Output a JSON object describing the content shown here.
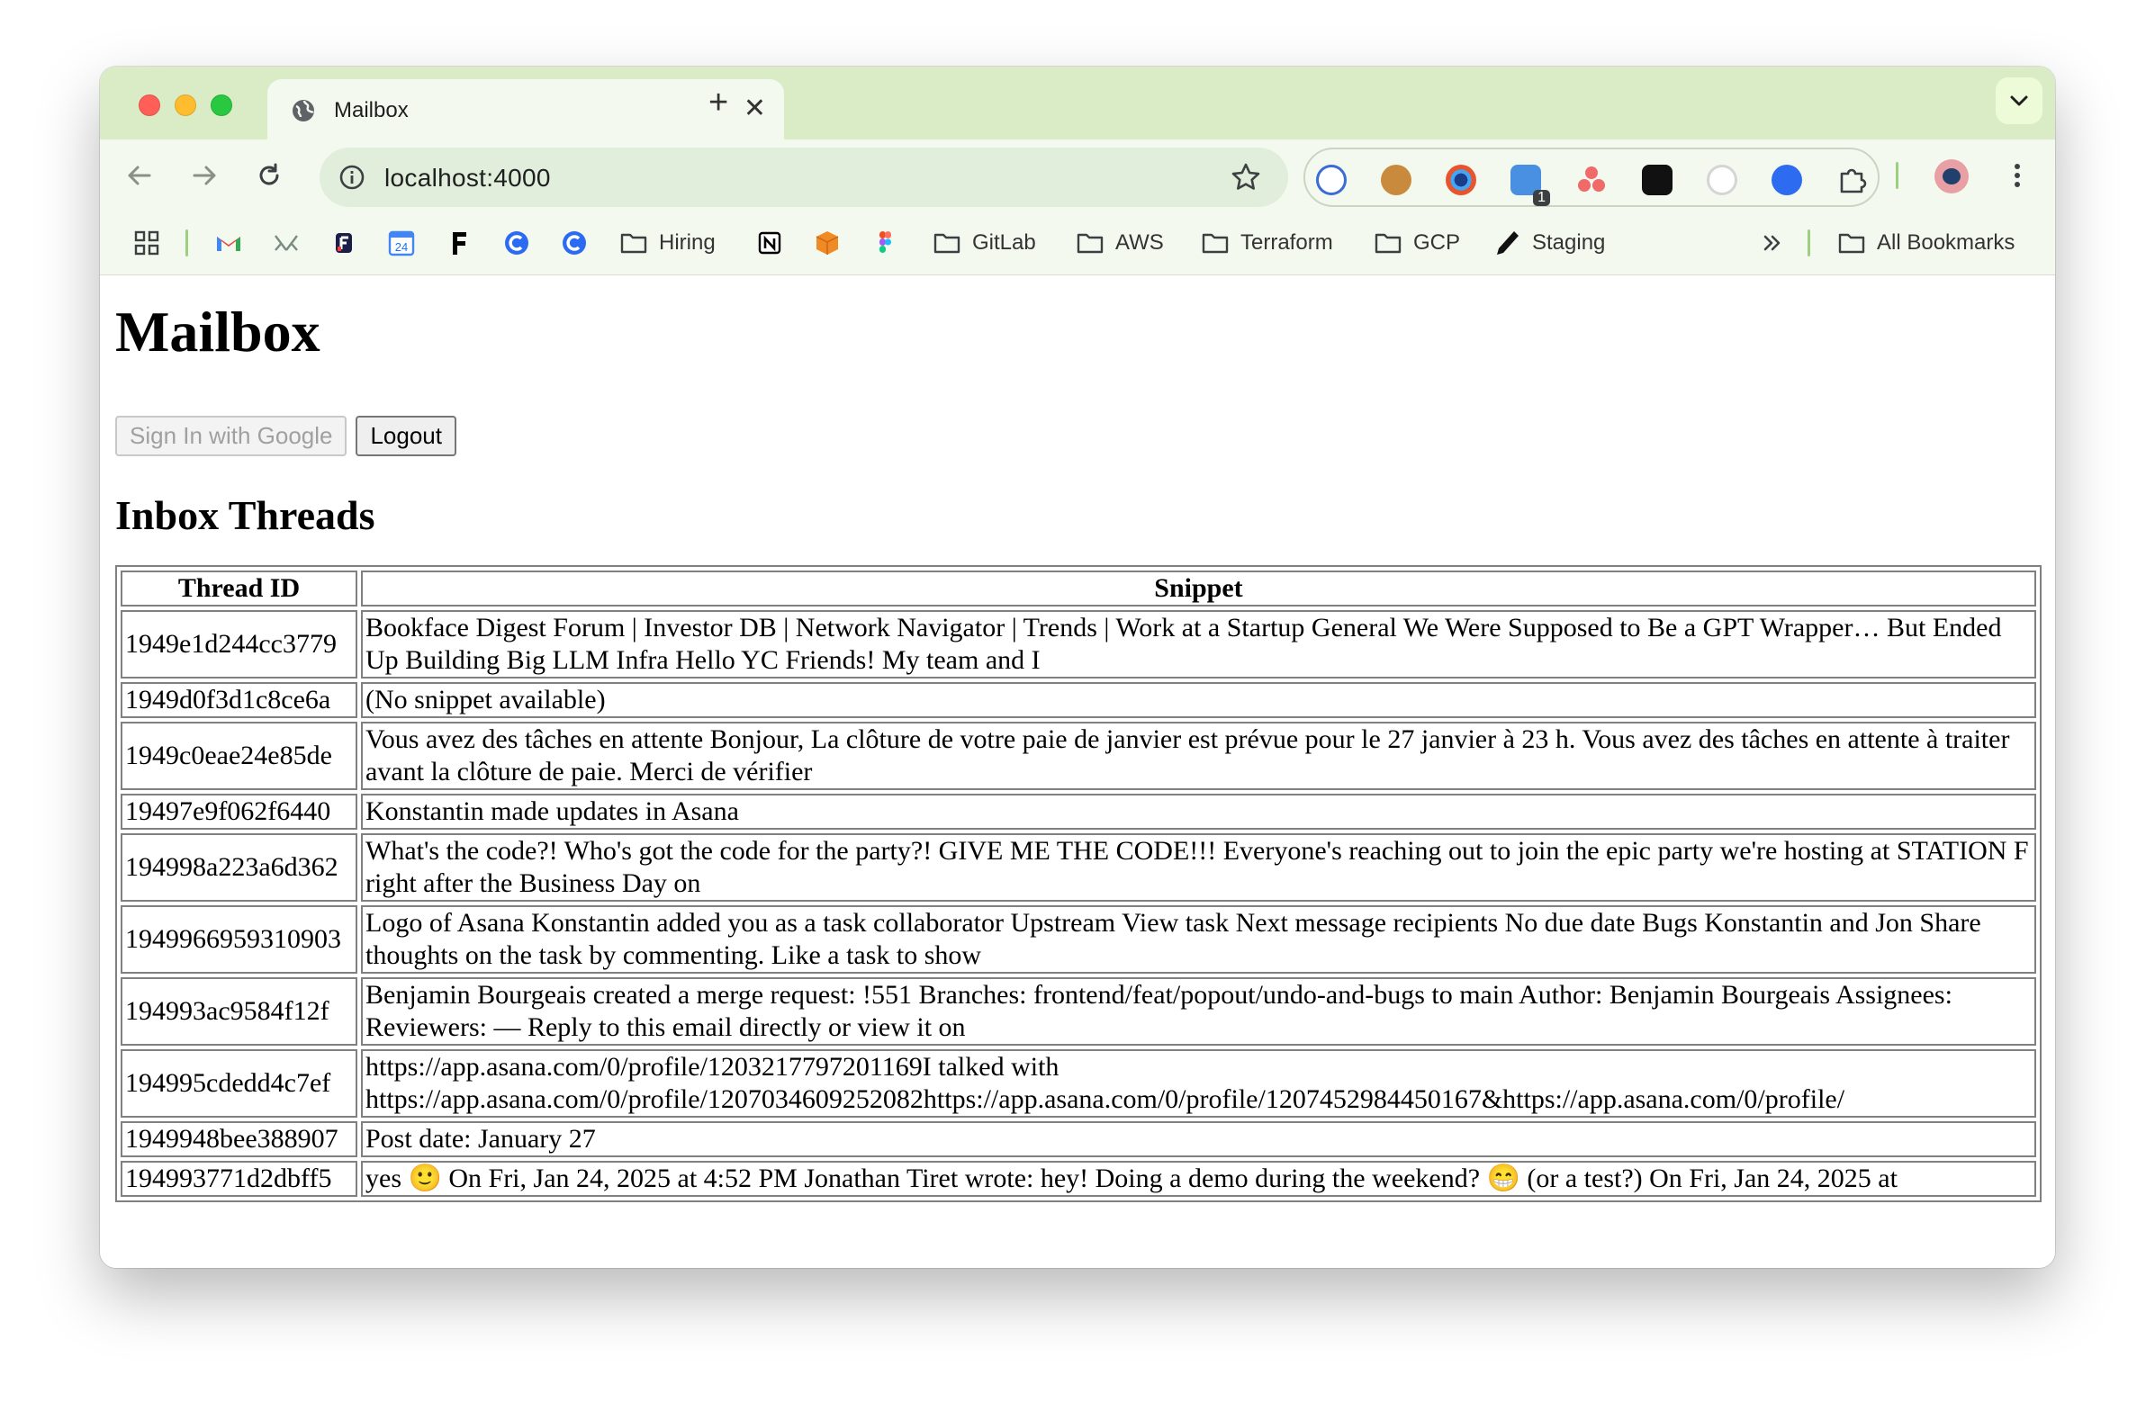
{
  "browser": {
    "tab_title": "Mailbox",
    "url": "localhost:4000",
    "extensions": [
      {
        "name": "password-manager-icon"
      },
      {
        "name": "cookie-icon"
      },
      {
        "name": "eye-extension-icon"
      },
      {
        "name": "badge-extension-icon",
        "badge": "1"
      },
      {
        "name": "asana-icon"
      },
      {
        "name": "tampermonkey-icon"
      },
      {
        "name": "loading-extension-icon"
      },
      {
        "name": "shield-extension-icon"
      },
      {
        "name": "puzzle-icon"
      }
    ],
    "bookmarks": [
      {
        "label": "Hiring"
      },
      {
        "label": "GitLab"
      },
      {
        "label": "AWS"
      },
      {
        "label": "Terraform"
      },
      {
        "label": "GCP"
      },
      {
        "label": "Staging"
      },
      {
        "label": "All Bookmarks"
      }
    ],
    "calendar_day": "24"
  },
  "page": {
    "title": "Mailbox",
    "signin_label": "Sign In with Google",
    "logout_label": "Logout",
    "section_title": "Inbox Threads",
    "table": {
      "headers": [
        "Thread ID",
        "Snippet"
      ],
      "rows": [
        {
          "id": "1949e1d244cc3779",
          "snippet": "Bookface Digest Forum | Investor DB | Network Navigator | Trends | Work at a Startup General We Were Supposed to Be a GPT Wrapper… But Ended Up Building Big LLM Infra Hello YC Friends! My team and I"
        },
        {
          "id": "1949d0f3d1c8ce6a",
          "snippet": "(No snippet available)"
        },
        {
          "id": "1949c0eae24e85de",
          "snippet": "Vous avez des tâches en attente Bonjour, La clôture de votre paie de janvier est prévue pour le 27 janvier à 23 h. Vous avez des tâches en attente à traiter avant la clôture de paie. Merci de vérifier"
        },
        {
          "id": "19497e9f062f6440",
          "snippet": "Konstantin made updates in Asana"
        },
        {
          "id": "194998a223a6d362",
          "snippet": "What's the code?! Who's got the code for the party?! GIVE ME THE CODE!!! Everyone's reaching out to join the epic party we're hosting at STATION F right after the Business Day on"
        },
        {
          "id": "1949966959310903",
          "snippet": "Logo of Asana Konstantin added you as a task collaborator Upstream View task Next message recipients No due date Bugs Konstantin and Jon Share thoughts on the task by commenting. Like a task to show"
        },
        {
          "id": "194993ac9584f12f",
          "snippet": "Benjamin Bourgeais created a merge request: !551 Branches: frontend/feat/popout/undo-and-bugs to main Author: Benjamin Bourgeais Assignees: Reviewers: — Reply to this email directly or view it on"
        },
        {
          "id": "194995cdedd4c7ef",
          "snippet": "https://app.asana.com/0/profile/1203217797201169I talked with https://app.asana.com/0/profile/1207034609252082https://app.asana.com/0/profile/1207452984450167&https://app.asana.com/0/profile/"
        },
        {
          "id": "1949948bee388907",
          "snippet": "Post date: January 27"
        },
        {
          "id": "194993771d2dbff5",
          "snippet": "yes 🙂 On Fri, Jan 24, 2025 at 4:52 PM Jonathan Tiret wrote: hey! Doing a demo during the weekend? 😁 (or a test?) On Fri, Jan 24, 2025 at"
        }
      ]
    }
  }
}
